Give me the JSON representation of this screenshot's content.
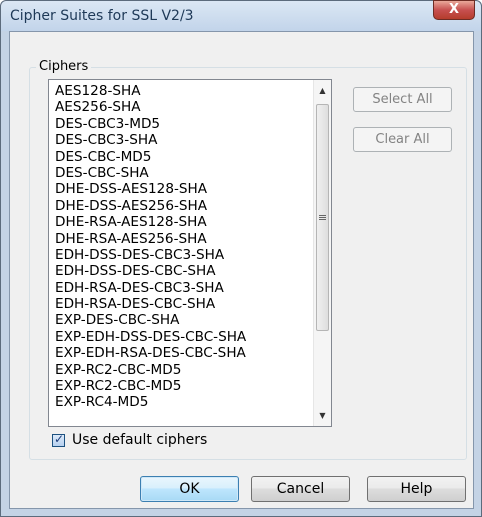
{
  "window": {
    "title": "Cipher Suites for SSL V2/3",
    "close_glyph": "X"
  },
  "group": {
    "label": "Ciphers"
  },
  "cipher_list": {
    "items": [
      "AES128-SHA",
      "AES256-SHA",
      "DES-CBC3-MD5",
      "DES-CBC3-SHA",
      "DES-CBC-MD5",
      "DES-CBC-SHA",
      "DHE-DSS-AES128-SHA",
      "DHE-DSS-AES256-SHA",
      "DHE-RSA-AES128-SHA",
      "DHE-RSA-AES256-SHA",
      "EDH-DSS-DES-CBC3-SHA",
      "EDH-DSS-DES-CBC-SHA",
      "EDH-RSA-DES-CBC3-SHA",
      "EDH-RSA-DES-CBC-SHA",
      "EXP-DES-CBC-SHA",
      "EXP-EDH-DSS-DES-CBC-SHA",
      "EXP-EDH-RSA-DES-CBC-SHA",
      "EXP-RC2-CBC-MD5",
      "EXP-RC2-CBC-MD5",
      "EXP-RC4-MD5"
    ],
    "scroll_up_glyph": "▲",
    "scroll_down_glyph": "▼"
  },
  "actions": {
    "select_all": "Select All",
    "clear_all": "Clear All"
  },
  "options": {
    "use_default_label": "Use default ciphers",
    "use_default_checked": true,
    "check_glyph": "✓"
  },
  "buttons": {
    "ok": "OK",
    "cancel": "Cancel",
    "help": "Help"
  },
  "colors": {
    "title_text": "#1e3957",
    "close_button": "#c75050",
    "disabled_text": "#838383",
    "default_button_border": "#3c7fb1"
  }
}
